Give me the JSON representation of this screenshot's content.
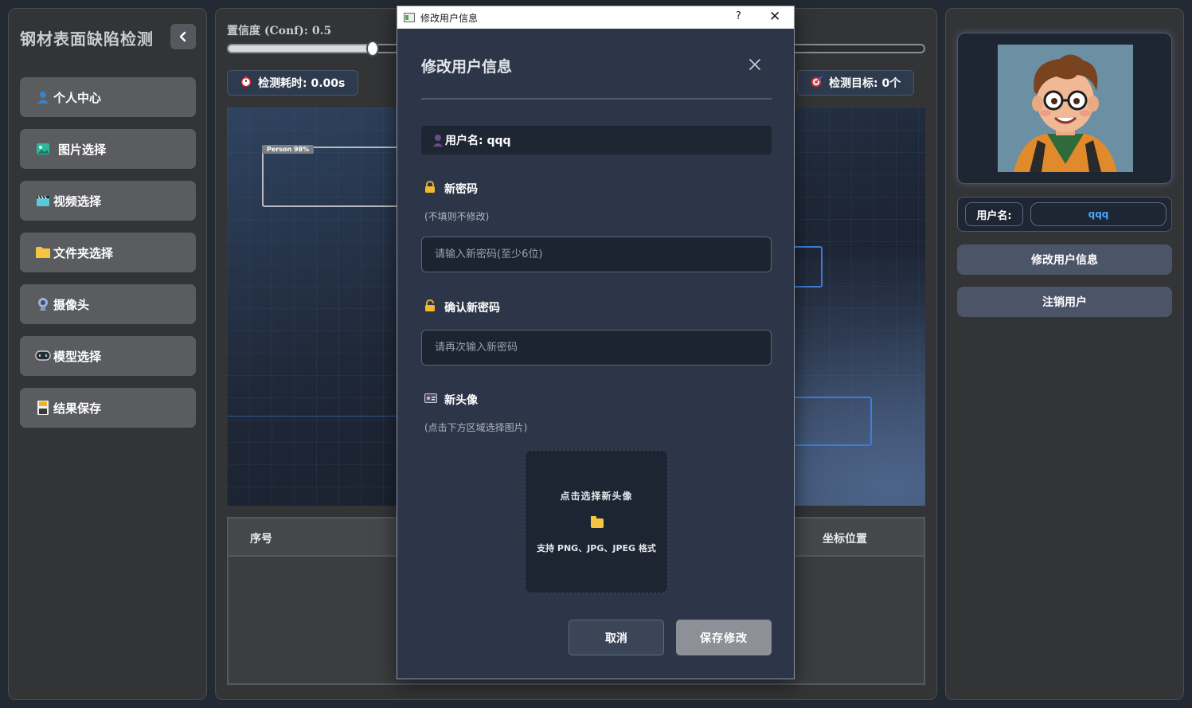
{
  "sidebar": {
    "title": "钢材表面缺陷检测",
    "items": [
      {
        "label": "个人中心",
        "icon": "user-icon"
      },
      {
        "label": "图片选择",
        "icon": "image-icon"
      },
      {
        "label": "视频选择",
        "icon": "clapperboard-icon"
      },
      {
        "label": "文件夹选择",
        "icon": "folder-icon"
      },
      {
        "label": "摄像头",
        "icon": "webcam-icon"
      },
      {
        "label": "模型选择",
        "icon": "model-icon"
      },
      {
        "label": "结果保存",
        "icon": "save-icon"
      }
    ]
  },
  "center": {
    "conf_label": "置信度 (Conf): 0.5",
    "conf_value": 0.5,
    "time_label": "检测耗时: 0.00s",
    "target_label": "检测目标: 0个",
    "bbox_label": "Person 98%",
    "table_headers": {
      "index": "序号",
      "coords": "坐标位置"
    }
  },
  "right": {
    "username_key": "用户名:",
    "username_value": "qqq",
    "edit_button": "修改用户信息",
    "logout_button": "注销用户"
  },
  "dialog": {
    "window_title": "修改用户信息",
    "help_glyph": "?",
    "close_glyph": "✕",
    "heading": "修改用户信息",
    "user_line": "用户名: qqq",
    "new_password_label": "新密码",
    "new_password_hint": "(不填则不修改)",
    "new_password_placeholder": "请输入新密码(至少6位)",
    "confirm_label": "确认新密码",
    "confirm_placeholder": "请再次输入新密码",
    "avatar_label": "新头像",
    "avatar_hint": "(点击下方区域选择图片)",
    "upload_title": "点击选择新头像",
    "upload_formats": "支持 PNG、JPG、JPEG 格式",
    "cancel_button": "取消",
    "save_button": "保存修改"
  },
  "colors": {
    "accent_blue": "#4da3ff",
    "dialog_bg": "#2d3648",
    "panel_bg": "#333436"
  }
}
